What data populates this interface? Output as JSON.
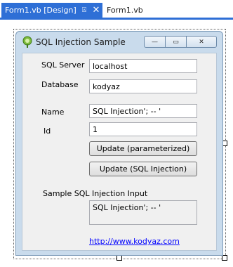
{
  "tabs": {
    "active_label": "Form1.vb [Design]",
    "inactive_label": "Form1.vb",
    "pin_glyph": "⍓",
    "close_glyph": "✕"
  },
  "form": {
    "title": "SQL Injection Sample",
    "min_glyph": "—",
    "max_glyph": "▭",
    "close_glyph": "✕"
  },
  "fields": {
    "server_label": "SQL Server",
    "server_value": "localhost",
    "database_label": "Database",
    "database_value": "kodyaz",
    "name_label": "Name",
    "name_value": "SQL Injection'; -- '",
    "id_label": "Id",
    "id_value": "1"
  },
  "buttons": {
    "update_param": "Update (parameterized)",
    "update_injection": "Update (SQL Injection)"
  },
  "sample": {
    "label": "Sample SQL Injection Input",
    "value": "SQL Injection'; -- '"
  },
  "link": {
    "text": "http://www.kodyaz.com"
  }
}
